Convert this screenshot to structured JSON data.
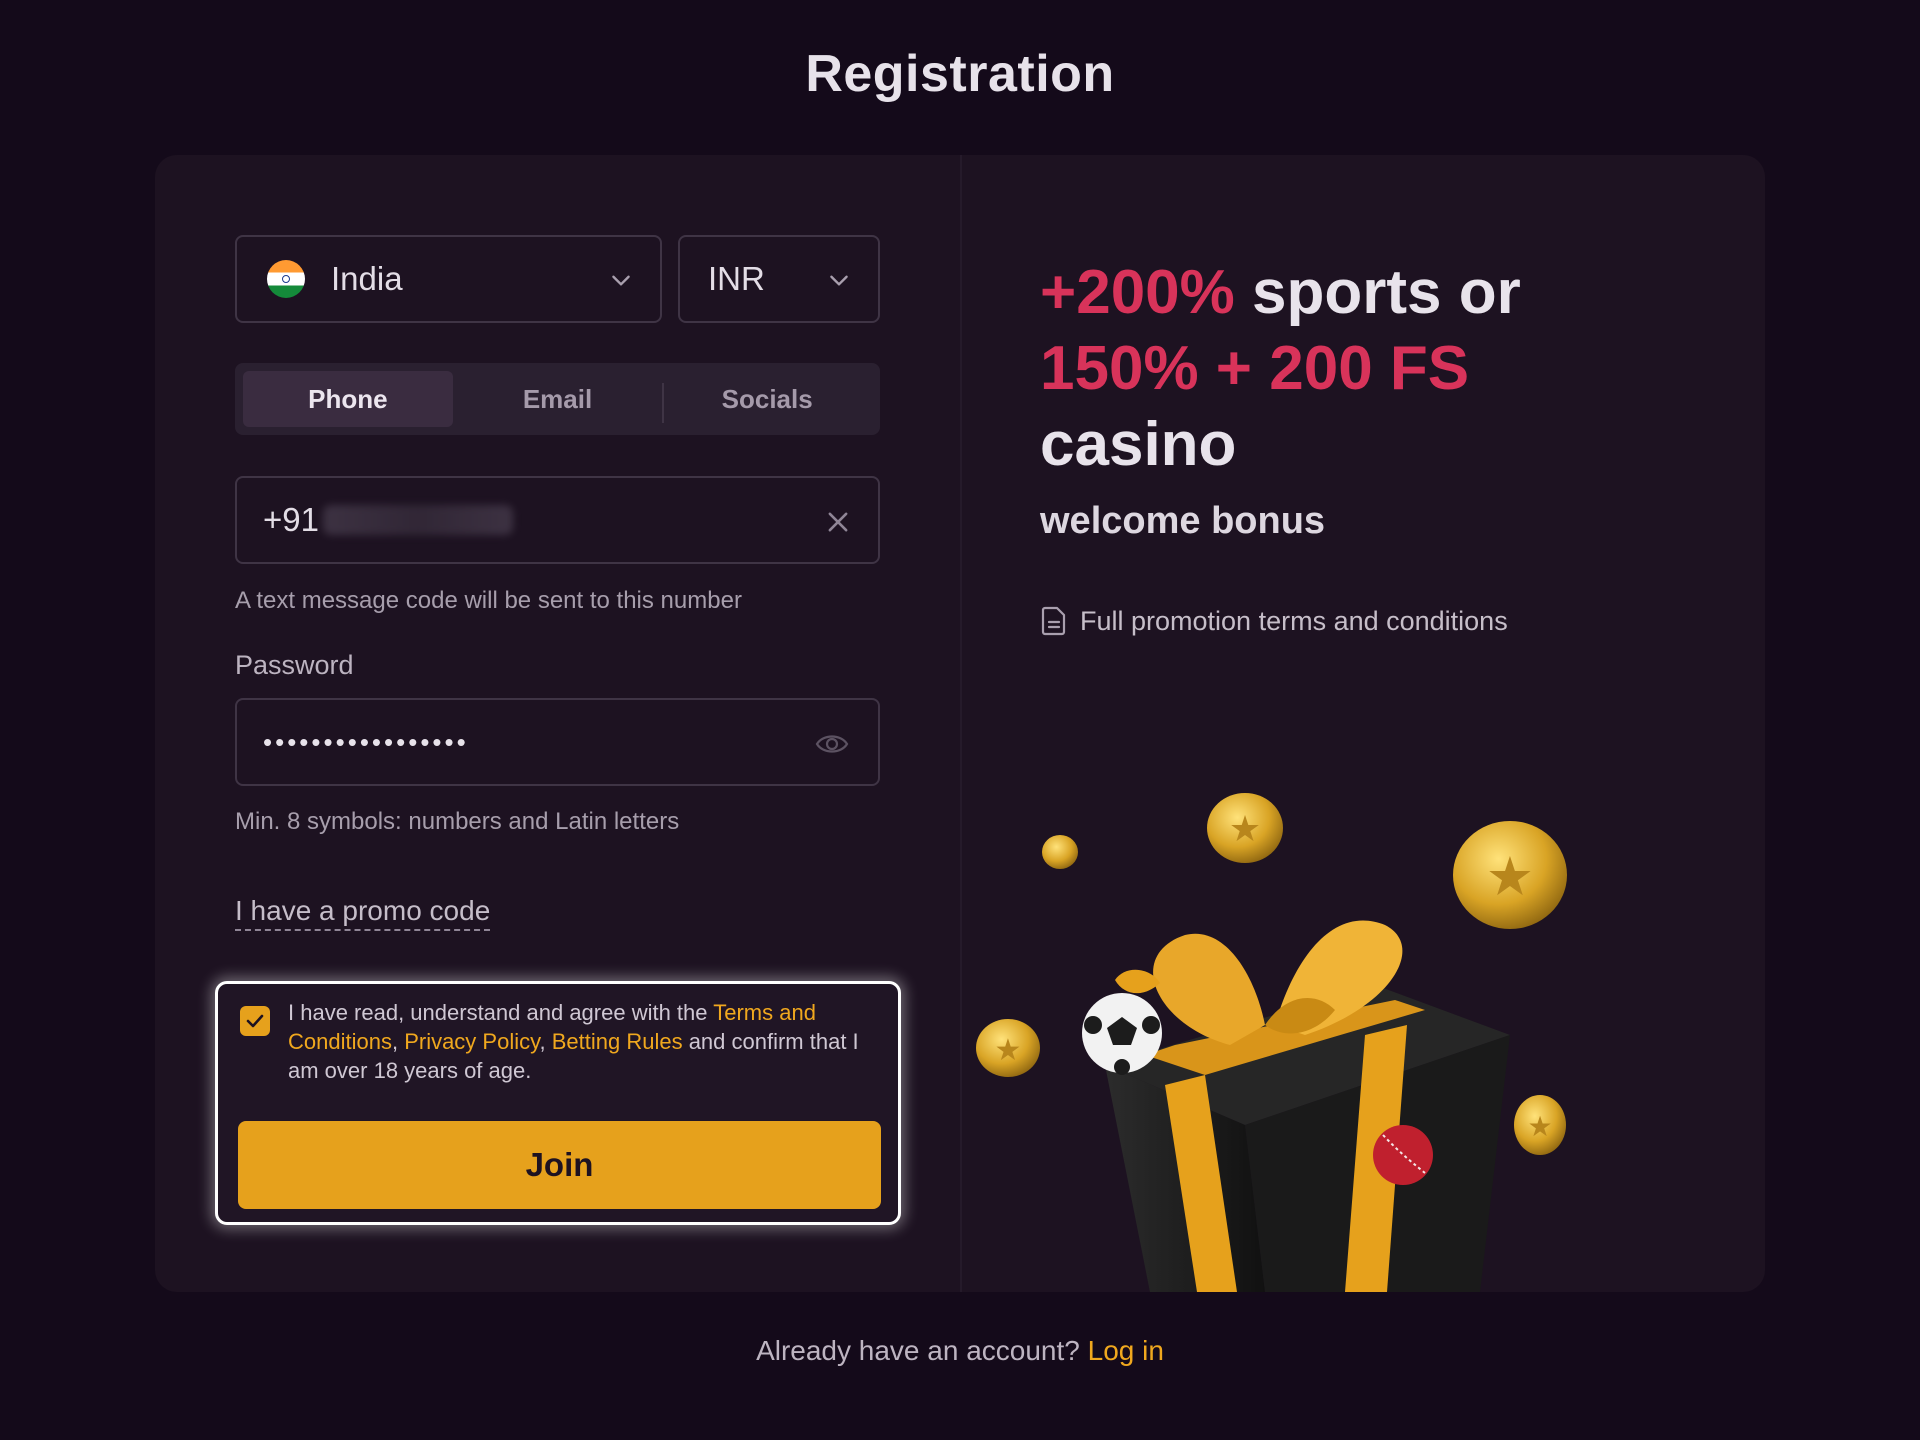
{
  "page": {
    "title": "Registration"
  },
  "form": {
    "country": {
      "value": "India",
      "flag_icon": "india-flag-icon"
    },
    "currency": {
      "value": "INR"
    },
    "tabs": [
      {
        "label": "Phone",
        "active": true
      },
      {
        "label": "Email",
        "active": false
      },
      {
        "label": "Socials",
        "active": false
      }
    ],
    "phone": {
      "prefix": "+91",
      "hint": "A text message code will be sent to this number"
    },
    "password": {
      "label": "Password",
      "masked_value": "•••••••••••••••••",
      "hint": "Min. 8 symbols: numbers and Latin letters"
    },
    "promo_link": "I have a promo code",
    "consent": {
      "checked": true,
      "text_before": "I have read, understand and agree with the ",
      "terms_link": "Terms and Conditions",
      "separator1": ", ",
      "privacy_link": "Privacy Policy",
      "separator2": ", ",
      "betting_link": "Betting Rules",
      "text_after": " and confirm that I am over 18 years of age."
    },
    "join_button": "Join"
  },
  "promo": {
    "accent1": "+200%",
    "text1": " sports or ",
    "accent2": "150% + 200 FS",
    "text2": "casino",
    "subtitle": "welcome bonus",
    "terms_link": "Full promotion terms and conditions"
  },
  "footer": {
    "question": "Already have an account? ",
    "login_link": "Log in"
  },
  "colors": {
    "accent_orange": "#e6a11c",
    "accent_red": "#d8335a",
    "background": "#140a1a",
    "card": "#1d1221"
  }
}
